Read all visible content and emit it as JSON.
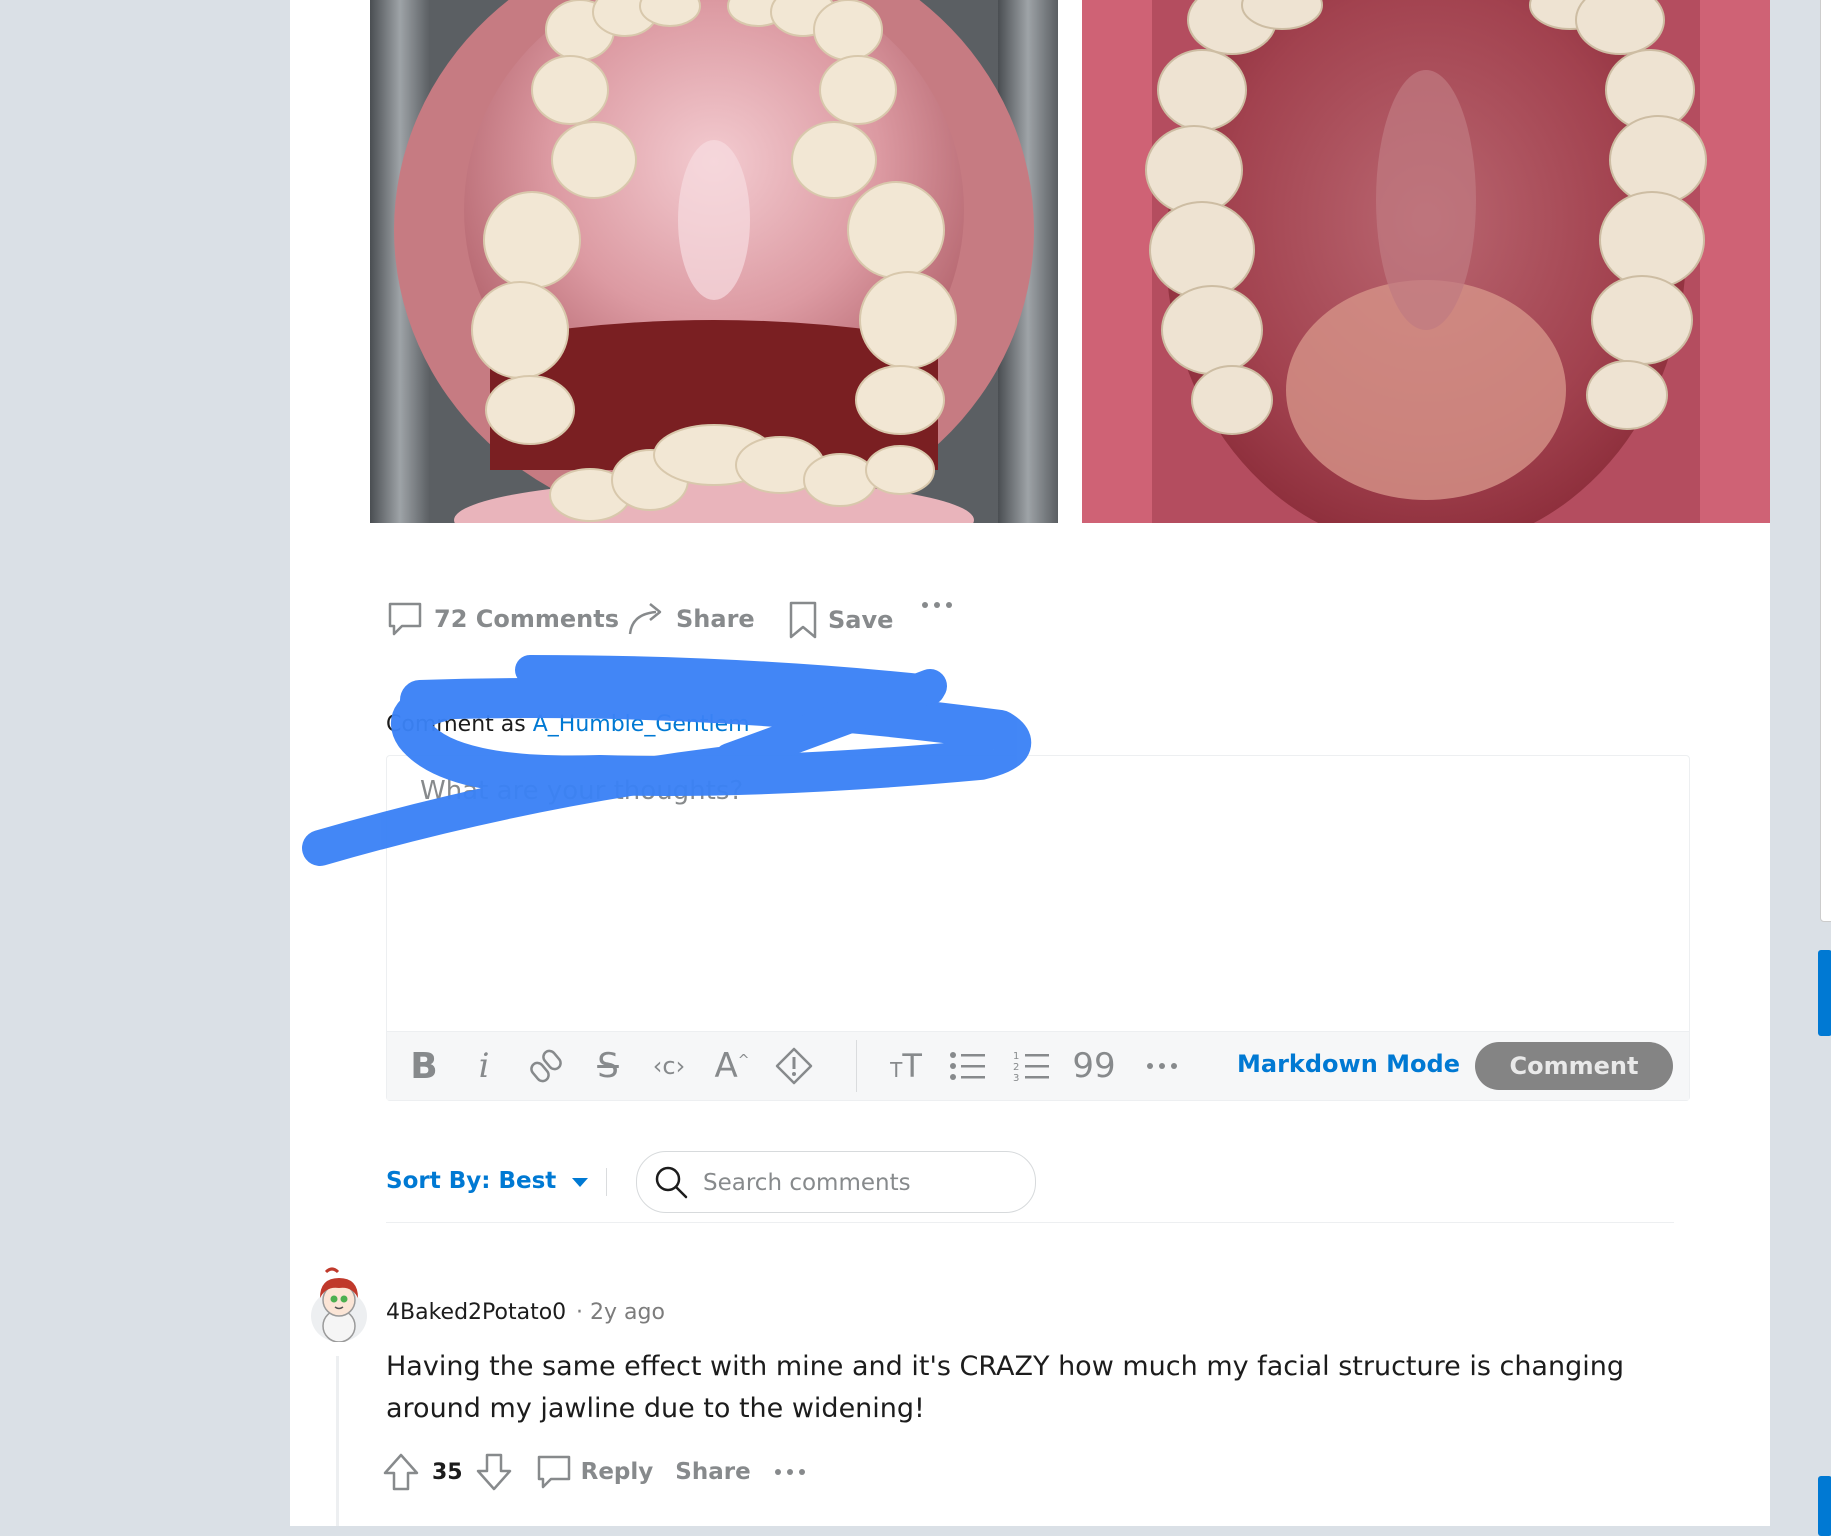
{
  "post": {
    "image_left_alt": "",
    "image_right_alt": "",
    "actions": {
      "comments_label": "72 Comments",
      "share_label": "Share",
      "save_label": "Save",
      "more_icon": "ellipsis-icon"
    }
  },
  "composer": {
    "comment_as_prefix": "Comment as",
    "username": "A_Humble_Gentlem",
    "placeholder": "What are your thoughts?",
    "toolbar": {
      "markdown_mode_label": "Markdown Mode",
      "comment_button_label": "Comment",
      "icons": [
        "bold-icon",
        "italic-icon",
        "link-icon",
        "strikethrough-icon",
        "inline-code-icon",
        "superscript-icon",
        "spoiler-icon",
        "heading-icon",
        "bulleted-list-icon",
        "numbered-list-icon",
        "quote-block-icon",
        "more-icon"
      ]
    }
  },
  "sort": {
    "label": "Sort By: Best",
    "search_placeholder": "Search comments"
  },
  "comments": [
    {
      "author": "4Baked2Potato0",
      "age": "· 2y ago",
      "body": "Having the same effect with mine and it's CRAZY how much my facial structure is changing around my jawline due to the widening!",
      "score": "35",
      "reply_label": "Reply",
      "share_label": "Share"
    }
  ],
  "colors": {
    "accent": "#0079d3",
    "scribble": "#3b82f6",
    "muted": "#878a8c",
    "background": "#dae0e6"
  }
}
